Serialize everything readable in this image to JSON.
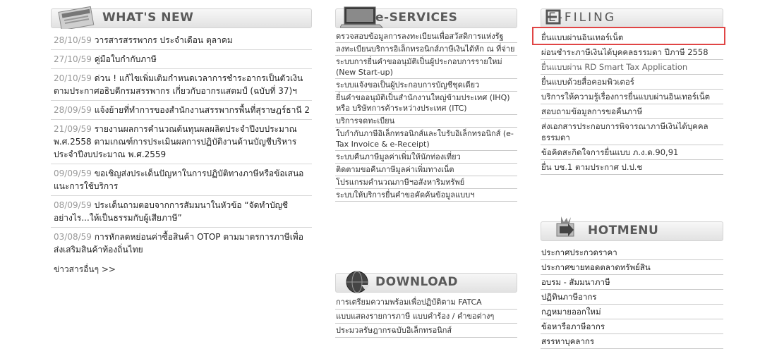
{
  "whats_new": {
    "title": "WHAT'S NEW",
    "icon": "newspaper-icon",
    "items": [
      {
        "date": "28/10/59",
        "text": "วารสารสรรพากร ประจำเดือน ตุลาคม"
      },
      {
        "date": "27/10/59",
        "text": "คู่มือใบกำกับภาษี"
      },
      {
        "date": "20/10/59",
        "text": "ด่วน ! แก้ไขเพิ่มเติมกำหนดเวลาการชำระอากรเป็นตัวเงินตามประกาศอธิบดีกรมสรรพากร เกี่ยวกับอากรแสตมป์ (ฉบับที่ 37)ฯ"
      },
      {
        "date": "28/09/59",
        "text": "แจ้งย้ายที่ทำการของสำนักงานสรรพากรพื้นที่สุราษฎร์ธานี 2"
      },
      {
        "date": "21/09/59",
        "text": "รายงานผลการคำนวณต้นทุนผลผลิตประจำปีงบประมาณ พ.ศ.2558 ตามเกณฑ์การประเมินผลการปฏิบัติงานด้านบัญชีบริหารประจำปีงบประมาณ พ.ศ.2559"
      },
      {
        "date": "09/09/59",
        "text": "ขอเชิญส่งประเด็นปัญหาในการปฏิบัติทางภาษีหรือข้อเสนอแนะการใช้บริการ"
      },
      {
        "date": "08/09/59",
        "text": "ประเด็นถามตอบจากการสัมมนาในหัวข้อ “จัดทำบัญชีอย่างไร...ให้เป็นธรรมกับผู้เสียภาษี”"
      },
      {
        "date": "03/08/59",
        "text": "การหักลดหย่อนค่าซื้อสินค้า OTOP ตามมาตรการภาษีเพื่อส่งเสริมสินค้าท้องถิ่นไทย"
      }
    ],
    "more": "ข่าวสารอื่นๆ >>"
  },
  "e_services": {
    "title": "e-SERVICES",
    "icon": "laptop-icon",
    "items": [
      "ตรวจสอบข้อมูลการลงทะเบียนเพื่อสวัสดิการแห่งรัฐ",
      "ลงทะเบียนบริการอิเล็กทรอนิกส์ภาษีเงินได้หัก ณ ที่จ่าย",
      "ระบบการยื่นคำขออนุมัติเป็นผู้ประกอบการรายใหม่ (New Start-up)",
      "ระบบแจ้งขอเป็นผู้ประกอบการบัญชีชุดเดียว",
      "ยื่นคำขออนุมัติเป็นสำนักงานใหญ่ข้ามประเทศ (IHQ) หรือ บริษัทการค้าระหว่างประเทศ (ITC)",
      "บริการจดทะเบียน",
      "ใบกำกับภาษีอิเล็กทรอนิกส์และใบรับอิเล็กทรอนิกส์ (e-Tax Invoice & e-Receipt)",
      "ระบบคืนภาษีมูลค่าเพิ่มให้นักท่องเที่ยว",
      "ติดตามขอคืนภาษีมูลค่าเพิ่มทางเน็ต",
      "โปรแกรมคำนวณภาษีฯอสังหาริมทรัพย์",
      "ระบบให้บริการยื่นคำขอคัดค้นข้อมูลแบบฯ"
    ]
  },
  "download": {
    "title": "DOWNLOAD",
    "icon": "globe-download-icon",
    "items": [
      "การเตรียมความพร้อมเพื่อปฏิบัติตาม FATCA",
      "แบบแสดงรายการภาษี แบบคำร้อง / คำขอต่างๆ",
      "ประมวลรัษฎากรฉบับอิเล็กทรอนิกส์"
    ]
  },
  "e_filing": {
    "title": "E-FILING",
    "items": [
      "ยื่นแบบผ่านอินเทอร์เน็ต",
      "ผ่อนชำระภาษีเงินได้บุคคลธรรมดา ปีภาษี 2558",
      "ยื่นแบบผ่าน RD Smart Tax Application",
      "ยื่นแบบด้วยสื่อคอมพิวเตอร์",
      "บริการให้ความรู้เรื่องการยื่นแบบผ่านอินเทอร์เน็ต",
      "สอบถามข้อมูลการขอคืนภาษี",
      "ส่งเอกสารประกอบการพิจารณาภาษีเงินได้บุคคลธรรมดา",
      "ข้อคิดสะกิดใจการยื่นแบบ ภ.ง.ด.90,91",
      "ยื่น บช.1 ตามประกาศ ป.ป.ช"
    ]
  },
  "hotmenu": {
    "title": "HOTMENU",
    "icon": "hot-arrow-icon",
    "items": [
      "ประกาศประกวดราคา",
      "ประกาศขายทอดตลาดทรัพย์สิน",
      "อบรม - สัมมนาภาษี",
      "ปฏิทินภาษีอากร",
      "กฎหมายออกใหม่",
      "ข้อหารือภาษีอากร",
      "สรรหาบุคลากร"
    ]
  },
  "colors": {
    "highlight": "#e04545",
    "date": "#999999",
    "header_text": "#5a5a5a"
  }
}
